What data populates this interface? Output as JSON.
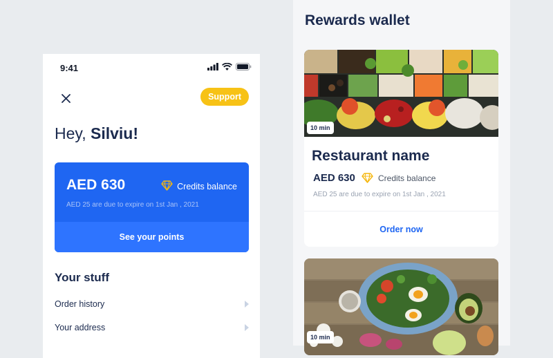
{
  "status_bar": {
    "time": "9:41",
    "icons": [
      "signal-icon",
      "wifi-icon",
      "battery-icon"
    ]
  },
  "header": {
    "close_icon": "close-icon",
    "support_label": "Support"
  },
  "greeting": {
    "prefix": "Hey, ",
    "name": "Silviu!"
  },
  "balance_card": {
    "amount": "AED 630",
    "credits_icon": "diamond-icon",
    "credits_label": "Credits balance",
    "expire_note": "AED 25 are due to expire on 1st Jan , 2021",
    "cta_label": "See your points"
  },
  "your_stuff": {
    "heading": "Your stuff",
    "items": [
      {
        "label": "Order history",
        "icon": "chevron-right-icon"
      },
      {
        "label": "Your address",
        "icon": "chevron-right-icon"
      }
    ]
  },
  "rewards_wallet": {
    "title": "Rewards wallet",
    "cards": [
      {
        "image": "salad-bar-photo",
        "time_badge": "10 min",
        "restaurant_name": "Restaurant name",
        "amount": "AED 630",
        "credits_icon": "diamond-icon",
        "credits_label": "Credits balance",
        "expire_note": "AED 25 are due to expire on 1st Jan , 2021",
        "cta_label": "Order now"
      },
      {
        "image": "salad-bowl-photo",
        "time_badge": "10 min"
      }
    ]
  },
  "colors": {
    "accent_blue": "#1f66f2",
    "support_yellow": "#f7c216",
    "diamond_gold": "#f5b70f",
    "heading_navy": "#1b2a4e",
    "page_background": "#e9ecef"
  }
}
